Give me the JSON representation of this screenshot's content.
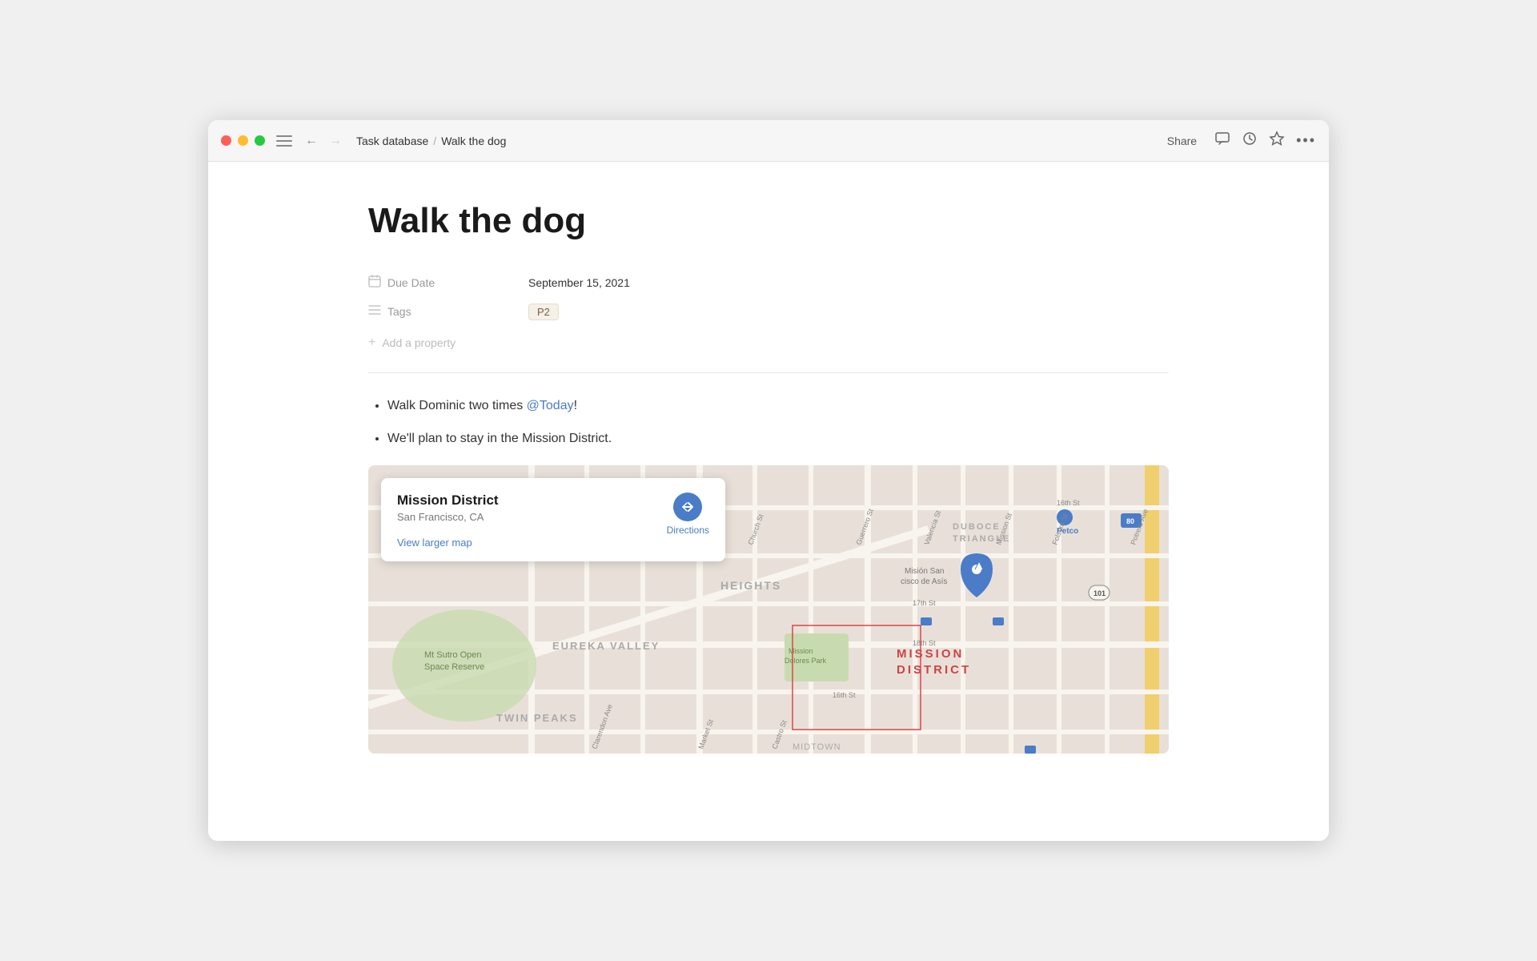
{
  "window": {
    "title": "Walk the dog",
    "breadcrumb_parent": "Task database",
    "breadcrumb_sep": "/",
    "breadcrumb_current": "Walk the dog"
  },
  "titlebar": {
    "share_label": "Share",
    "comment_icon": "💬",
    "history_icon": "🕐",
    "star_icon": "☆",
    "more_icon": "•••"
  },
  "page": {
    "title": "Walk the dog",
    "properties": {
      "due_date_label": "Due Date",
      "due_date_value": "September 15, 2021",
      "tags_label": "Tags",
      "tags_value": "P2",
      "add_property_label": "Add a property"
    },
    "bullet1_text": "Walk Dominic two times ",
    "bullet1_mention": "@Today",
    "bullet1_suffix": "!",
    "bullet2_text": "We'll plan to stay in the Mission District.",
    "map": {
      "popup_title": "Mission District",
      "popup_subtitle": "San Francisco, CA",
      "directions_label": "Directions",
      "view_larger_label": "View larger map"
    }
  },
  "icons": {
    "calendar": "📅",
    "tags": "☰",
    "add": "+",
    "back_arrow": "←",
    "forward_arrow": "→",
    "menu": "≡"
  }
}
